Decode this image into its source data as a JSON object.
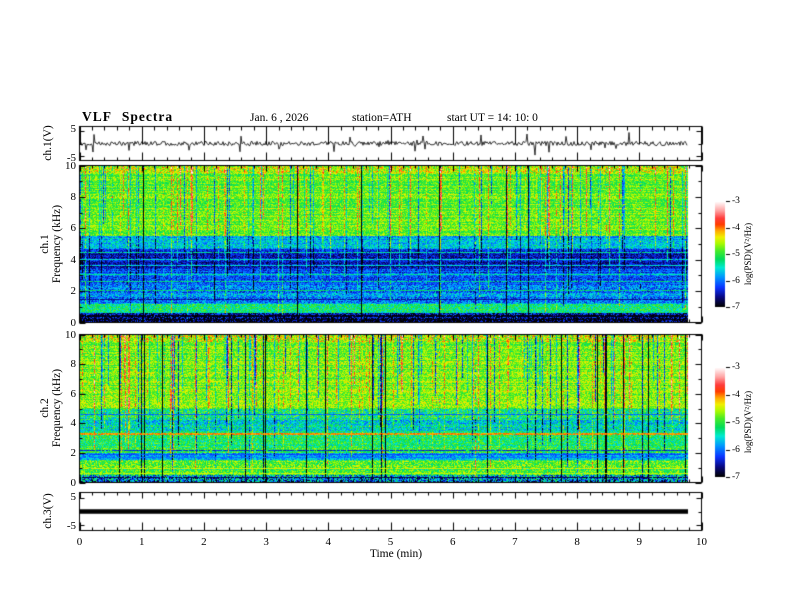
{
  "title": "VLF  Spectra",
  "header": {
    "date": "Jan. 6 , 2026",
    "station": "station=ATH",
    "start_ut": "start UT =  14: 10: 0"
  },
  "panels": {
    "wave1": {
      "label": "ch.1(V)",
      "yticks": [
        "5",
        "-5"
      ],
      "ylim": [
        -5,
        5
      ]
    },
    "spec1": {
      "label_ch": "ch.1",
      "label_axis": "Frequency (kHz)",
      "yticks": [
        "10",
        "8",
        "6",
        "4",
        "2",
        "0"
      ],
      "ylim": [
        0,
        10
      ]
    },
    "spec2": {
      "label_ch": "ch.2",
      "label_axis": "Frequency (kHz)",
      "yticks": [
        "10",
        "8",
        "6",
        "4",
        "2",
        "0"
      ],
      "ylim": [
        0,
        10
      ]
    },
    "wave3": {
      "label": "ch.3(V)",
      "yticks": [
        "5",
        "-5"
      ],
      "ylim": [
        -5,
        5
      ]
    }
  },
  "xaxis": {
    "label": "Time (min)",
    "ticks": [
      "0",
      "1",
      "2",
      "3",
      "4",
      "5",
      "6",
      "7",
      "8",
      "9",
      "10"
    ],
    "lim": [
      0,
      10
    ],
    "data_end_min": 9.78
  },
  "colorbar": {
    "label": "log(PSD)(V²/Hz)",
    "ticks": [
      "-3",
      "-4",
      "-5",
      "-6",
      "-7"
    ],
    "lim": [
      -7,
      -3
    ],
    "stops": [
      {
        "t": 0.0,
        "rgb": [
          0,
          0,
          0
        ]
      },
      {
        "t": 0.09,
        "rgb": [
          8,
          8,
          130
        ]
      },
      {
        "t": 0.18,
        "rgb": [
          10,
          50,
          255
        ]
      },
      {
        "t": 0.28,
        "rgb": [
          0,
          150,
          255
        ]
      },
      {
        "t": 0.37,
        "rgb": [
          0,
          235,
          210
        ]
      },
      {
        "t": 0.45,
        "rgb": [
          0,
          220,
          90
        ]
      },
      {
        "t": 0.53,
        "rgb": [
          70,
          235,
          40
        ]
      },
      {
        "t": 0.6,
        "rgb": [
          170,
          250,
          0
        ]
      },
      {
        "t": 0.66,
        "rgb": [
          240,
          240,
          0
        ]
      },
      {
        "t": 0.72,
        "rgb": [
          255,
          170,
          0
        ]
      },
      {
        "t": 0.78,
        "rgb": [
          255,
          60,
          0
        ]
      },
      {
        "t": 0.84,
        "rgb": [
          255,
          60,
          60
        ]
      },
      {
        "t": 0.91,
        "rgb": [
          255,
          160,
          160
        ]
      },
      {
        "t": 1.0,
        "rgb": [
          255,
          255,
          255
        ]
      }
    ]
  },
  "chart_data": [
    {
      "type": "line",
      "panel": "ch.1(V) waveform",
      "xlim": [
        0,
        10
      ],
      "ylim": [
        -5,
        5
      ],
      "data_extent_min": 9.78,
      "description": "Dense noisy black trace centered on 0 V, typical amplitude ±1 V with impulsive spikes reaching about ±4 V",
      "render": {
        "seed": 55,
        "base_amp": 0.75,
        "spike_prob": 0.05,
        "spike_amp": 2.6
      }
    },
    {
      "type": "heatmap",
      "panel": "ch.1 spectrogram",
      "xlabel": "Time (min)",
      "ylabel": "Frequency (kHz)",
      "xlim": [
        0,
        10
      ],
      "ylim": [
        0,
        10
      ],
      "zlabel": "log(PSD)(V²/Hz)",
      "zlim": [
        -7,
        -3
      ],
      "description": "Green/yellow above ~5.5 kHz with vertical sferic streaks (orange-red and dark); strong dark-blue absorption band ~3.4-5.5 kHz; blue with cyan horizontal lines 1-3.4 kHz; cyan-green ~0.6-1.2 kHz; near-black rows below 0.5 kHz",
      "render": {
        "seed": 101,
        "bands": [
          {
            "f": [
              9.55,
              10
            ],
            "base": -4.55,
            "noise": 0.55
          },
          {
            "f": [
              5.5,
              9.55
            ],
            "base": -4.8,
            "noise": 0.38
          },
          {
            "f": [
              4.7,
              5.5
            ],
            "base": -5.7,
            "noise": 0.45
          },
          {
            "f": [
              3.4,
              4.7
            ],
            "base": -6.45,
            "noise": 0.35
          },
          {
            "f": [
              2.4,
              3.4
            ],
            "base": -6.15,
            "noise": 0.4
          },
          {
            "f": [
              1.15,
              2.4
            ],
            "base": -5.95,
            "noise": 0.5
          },
          {
            "f": [
              0.55,
              1.15
            ],
            "base": -5.35,
            "noise": 0.5
          },
          {
            "f": [
              0.28,
              0.55
            ],
            "base": -6.55,
            "noise": 0.6
          },
          {
            "f": [
              0,
              0.28
            ],
            "base": -6.8,
            "noise": 0.8
          }
        ],
        "hlines": [
          {
            "f": 4.45,
            "value": -5.35,
            "w": 1
          },
          {
            "f": 4.0,
            "value": -5.5,
            "w": 1
          },
          {
            "f": 3.6,
            "value": -5.55,
            "w": 1
          },
          {
            "f": 3.05,
            "value": -5.35,
            "w": 1
          },
          {
            "f": 2.62,
            "value": -5.3,
            "w": 1
          },
          {
            "f": 2.0,
            "value": -5.2,
            "w": 1
          },
          {
            "f": 1.45,
            "value": -6.6,
            "w": 1
          },
          {
            "f": 0.42,
            "value": -6.95,
            "w": 2
          },
          {
            "f": 0.15,
            "value": -6.9,
            "w": 1
          }
        ],
        "streaks": {
          "hot_prob": 0.1,
          "hot_boost": 0.75,
          "cold_prob": 0.11,
          "cold_drop": 0.95,
          "dark_prob": 0.012,
          "dark_drop": 2.2
        }
      }
    },
    {
      "type": "heatmap",
      "panel": "ch.2 spectrogram",
      "xlabel": "Time (min)",
      "ylabel": "Frequency (kHz)",
      "xlim": [
        0,
        10
      ],
      "ylim": [
        0,
        10
      ],
      "zlabel": "log(PSD)(V²/Hz)",
      "zlim": [
        -7,
        -3
      ],
      "description": "Mostly green with many vertical streaks (red-orange hot, dark blue/black cold); speckled cyan band 3.5-5 kHz; red horizontal line near 3.3 kHz; dark olive band near 1.5-1.9 kHz; green with red/yellow speckle and dark rows below 0.5 kHz",
      "render": {
        "seed": 202,
        "bands": [
          {
            "f": [
              9.55,
              10
            ],
            "base": -4.5,
            "noise": 0.6
          },
          {
            "f": [
              5.0,
              9.55
            ],
            "base": -4.75,
            "noise": 0.4
          },
          {
            "f": [
              4.25,
              5.0
            ],
            "base": -5.35,
            "noise": 0.65
          },
          {
            "f": [
              3.45,
              4.25
            ],
            "base": -5.5,
            "noise": 0.55
          },
          {
            "f": [
              2.3,
              3.45
            ],
            "base": -5.15,
            "noise": 0.5
          },
          {
            "f": [
              1.95,
              2.3
            ],
            "base": -5.0,
            "noise": 0.45
          },
          {
            "f": [
              1.5,
              1.95
            ],
            "base": -5.75,
            "noise": 0.4
          },
          {
            "f": [
              0.45,
              1.5
            ],
            "base": -4.95,
            "noise": 0.5
          },
          {
            "f": [
              0,
              0.45
            ],
            "base": -5.9,
            "noise": 1.0
          }
        ],
        "hlines": [
          {
            "f": 3.3,
            "value": -4.05,
            "w": 2
          },
          {
            "f": 4.62,
            "value": -6.1,
            "w": 1
          },
          {
            "f": 2.12,
            "value": -6.4,
            "w": 1
          },
          {
            "f": 1.86,
            "value": -6.2,
            "w": 1
          },
          {
            "f": 1.7,
            "value": -6.0,
            "w": 1
          },
          {
            "f": 0.95,
            "value": -4.4,
            "w": 1
          },
          {
            "f": 0.6,
            "value": -4.5,
            "w": 1
          },
          {
            "f": 0.3,
            "value": -6.8,
            "w": 1
          }
        ],
        "streaks": {
          "hot_prob": 0.1,
          "hot_boost": 0.8,
          "cold_prob": 0.13,
          "cold_drop": 1.2,
          "dark_prob": 0.03,
          "dark_drop": 2.4
        }
      }
    },
    {
      "type": "line",
      "panel": "ch.3(V) waveform",
      "xlim": [
        0,
        10
      ],
      "ylim": [
        -5,
        5
      ],
      "value": 0,
      "data_extent_min": 9.78,
      "description": "Flat thick black line at 0 V for the whole record"
    }
  ]
}
